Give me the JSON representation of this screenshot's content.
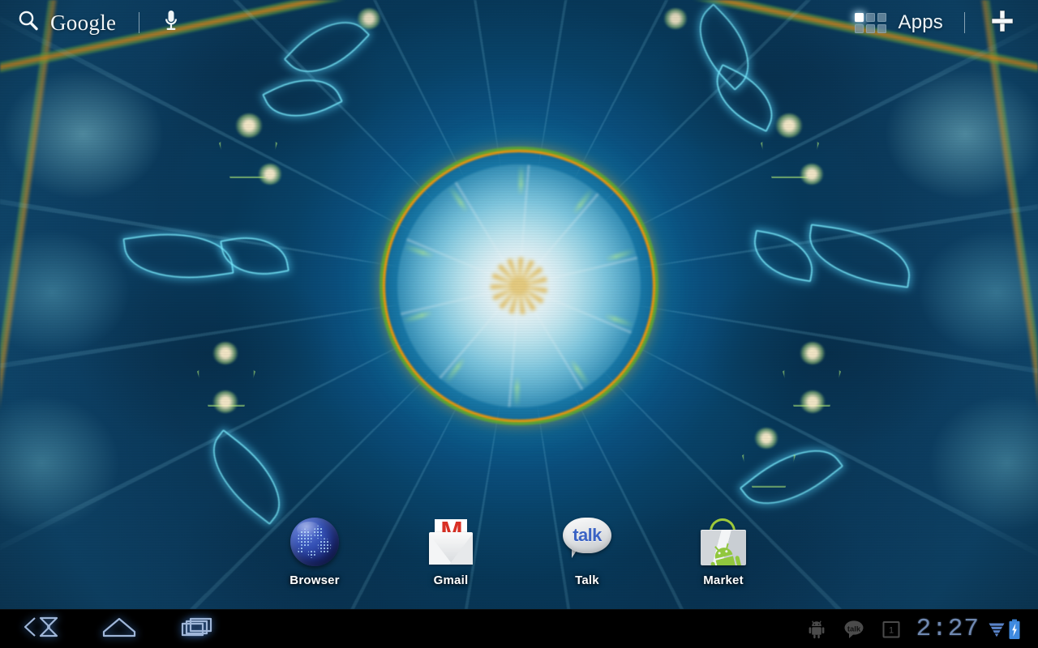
{
  "screen": {
    "device": "android-tablet-home",
    "wallpaper_name": "kaleidoscope-live-wallpaper"
  },
  "topbar": {
    "search": {
      "icon": "search-icon",
      "label": "Google",
      "voice_icon": "microphone-icon"
    },
    "apps": {
      "icon": "apps-grid-icon",
      "label": "Apps",
      "add_icon": "plus-icon"
    }
  },
  "hotseat": {
    "apps": [
      {
        "label": "Browser",
        "icon": "browser-globe-icon"
      },
      {
        "label": "Gmail",
        "icon": "gmail-envelope-icon",
        "mark": "M"
      },
      {
        "label": "Talk",
        "icon": "talk-bubble-icon",
        "mark": "talk"
      },
      {
        "label": "Market",
        "icon": "market-bag-icon"
      }
    ]
  },
  "systembar": {
    "nav": [
      {
        "name": "back",
        "icon": "back-arrow-icon"
      },
      {
        "name": "home",
        "icon": "home-icon"
      },
      {
        "name": "recents",
        "icon": "recent-apps-icon"
      }
    ],
    "notifications": [
      {
        "name": "usb-debugging",
        "icon": "android-robot-icon"
      },
      {
        "name": "talk-message",
        "icon": "talk-notification-icon",
        "mark": "talk"
      },
      {
        "name": "calendar-event",
        "icon": "calendar-icon",
        "mark": "1"
      }
    ],
    "clock": "2:27",
    "wifi": {
      "icon": "wifi-signal-icon",
      "bars": 4
    },
    "battery": {
      "icon": "battery-charging-icon",
      "charging": true
    }
  },
  "colors": {
    "accent_blue": "#6f88b0",
    "nav_glow": "#4a8ce6",
    "gmail_red": "#d93025",
    "talk_blue": "#3b63c4",
    "android_green": "#91c73e",
    "wallpaper_orange": "#ff960a",
    "wallpaper_teal": "#0a4f7e"
  }
}
